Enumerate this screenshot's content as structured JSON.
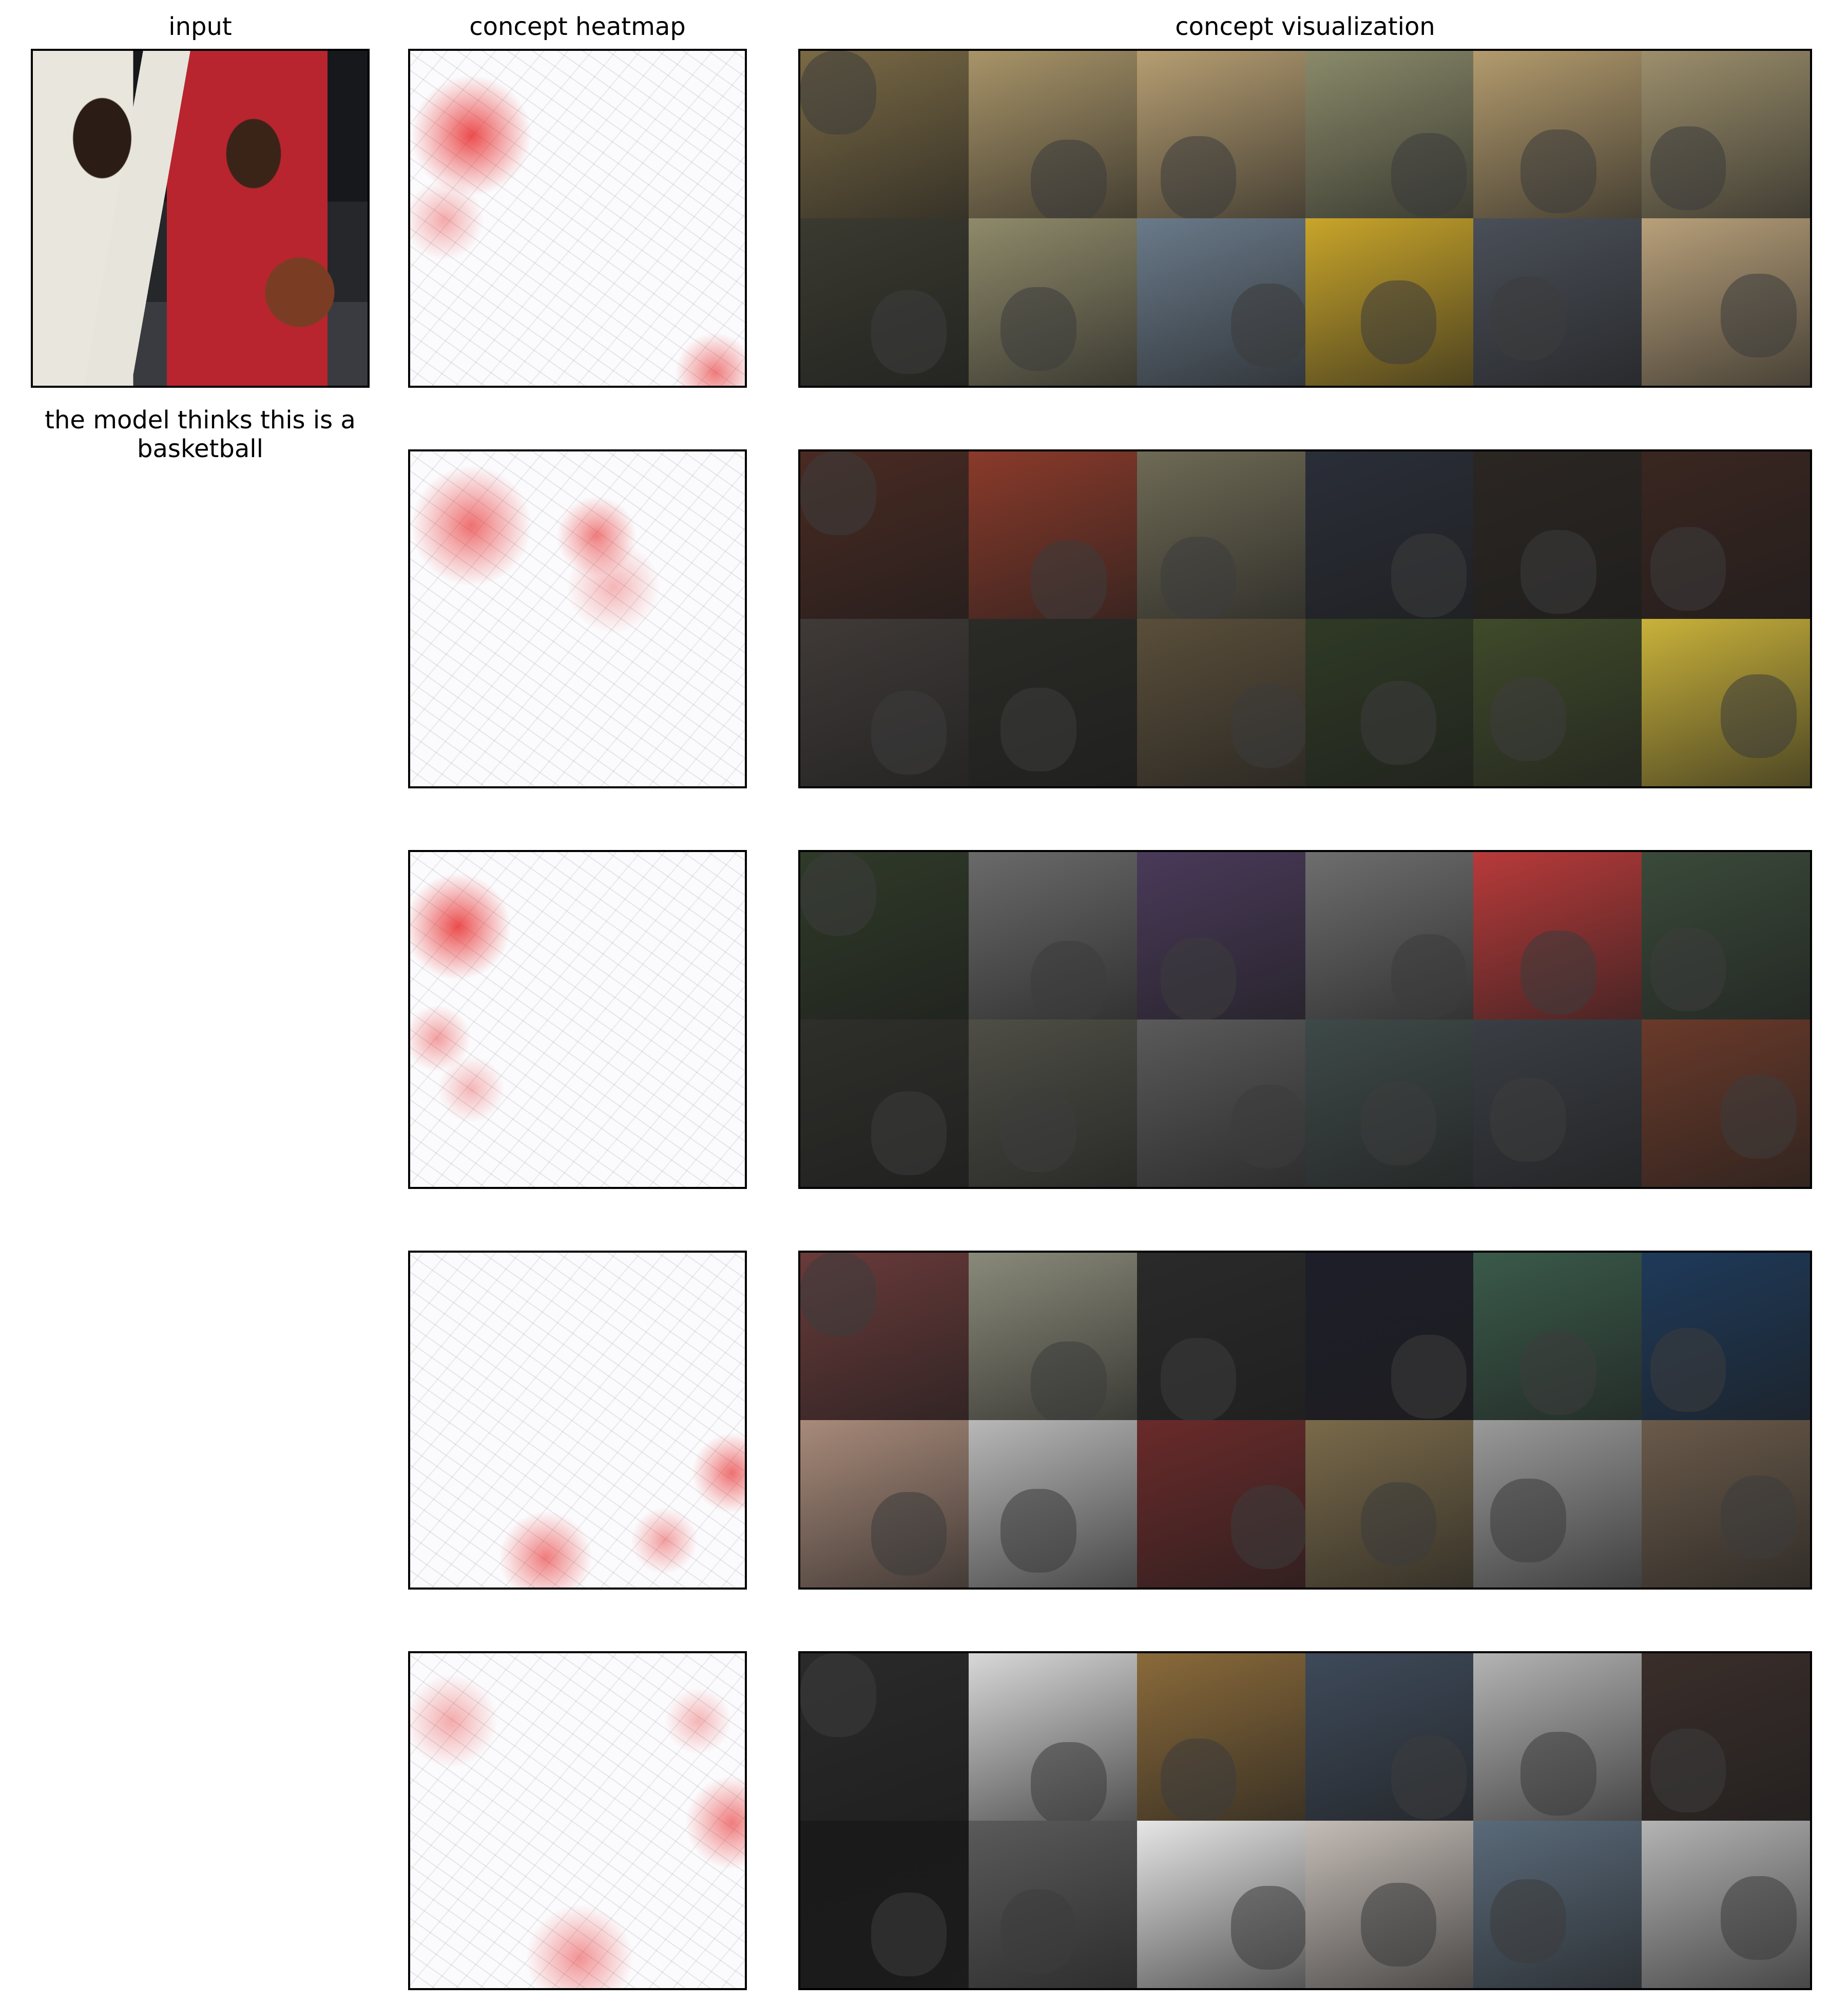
{
  "titles": {
    "input": "input",
    "heatmap": "concept heatmap",
    "visualization": "concept visualization"
  },
  "caption": "the model thinks this is a basketball",
  "concepts": [
    {
      "tiles": [
        "#7a6a45",
        "#a89468",
        "#b69e72",
        "#8a8a6a",
        "#b39b6d",
        "#9c8f6c",
        "#3a3a30",
        "#8f8a6a",
        "#6a7a8a",
        "#c9a52a",
        "#4a4f58",
        "#b8a07a"
      ],
      "heat_spots": [
        [
          18,
          25,
          18,
          0.75
        ],
        [
          10,
          50,
          12,
          0.35
        ],
        [
          90,
          95,
          12,
          0.55
        ]
      ]
    },
    {
      "tiles": [
        "#4a2a22",
        "#8a3a2a",
        "#6e6a55",
        "#2a2e38",
        "#2b2622",
        "#3a2620",
        "#3f3a38",
        "#2a2a26",
        "#5a4e3a",
        "#2f3a25",
        "#3f4a2a",
        "#c9b23a"
      ],
      "heat_spots": [
        [
          18,
          22,
          18,
          0.6
        ],
        [
          55,
          25,
          12,
          0.55
        ],
        [
          60,
          40,
          14,
          0.3
        ]
      ]
    },
    {
      "tiles": [
        "#2f3a28",
        "#6a6a6a",
        "#4a3a5a",
        "#6e6e6e",
        "#b93a3a",
        "#3a4a3a",
        "#2e2e2a",
        "#4e4e46",
        "#5a5a5a",
        "#3e4a48",
        "#3a3e44",
        "#6a3a2a"
      ],
      "heat_spots": [
        [
          14,
          22,
          16,
          0.75
        ],
        [
          8,
          55,
          10,
          0.4
        ],
        [
          18,
          70,
          10,
          0.3
        ]
      ]
    },
    {
      "tiles": [
        "#6a3a3a",
        "#8a8a7a",
        "#2a2a2a",
        "#1e1e2a",
        "#3a5a4a",
        "#1e3a5a",
        "#a88a7a",
        "#b8b8b8",
        "#6a2a2a",
        "#7a6a4a",
        "#9a9a9a",
        "#6a5a4a"
      ],
      "heat_spots": [
        [
          95,
          65,
          12,
          0.6
        ],
        [
          40,
          90,
          14,
          0.55
        ],
        [
          75,
          85,
          10,
          0.4
        ]
      ]
    },
    {
      "tiles": [
        "#2a2a2a",
        "#d8d8d8",
        "#8a6a3a",
        "#3e4a5a",
        "#b4b4b4",
        "#3a2e2a",
        "#1a1a1a",
        "#5a5a5a",
        "#e6e6e6",
        "#c4bcb6",
        "#5a6a7a",
        "#b4b4b4"
      ],
      "heat_spots": [
        [
          95,
          50,
          14,
          0.55
        ],
        [
          50,
          90,
          16,
          0.45
        ],
        [
          12,
          20,
          14,
          0.35
        ],
        [
          85,
          20,
          10,
          0.3
        ]
      ]
    }
  ]
}
